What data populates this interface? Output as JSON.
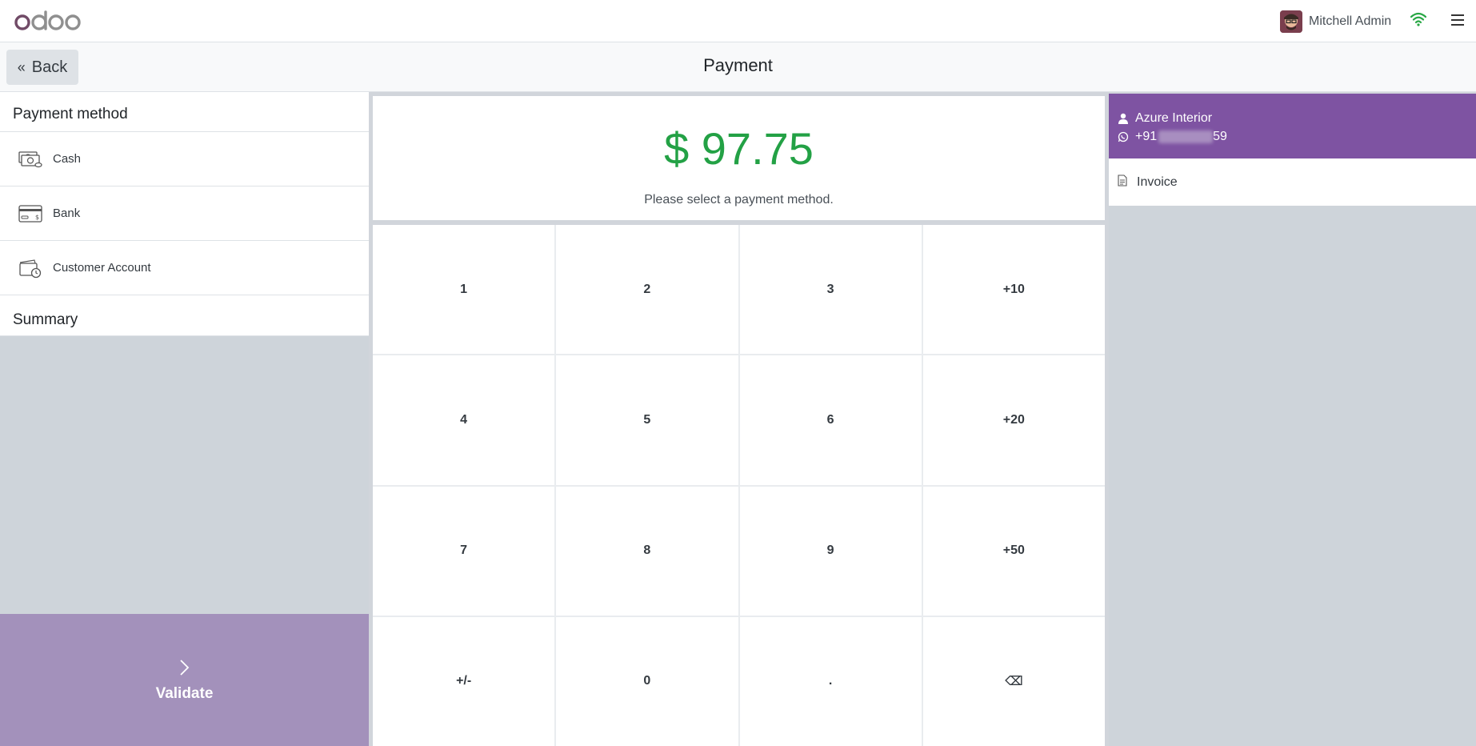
{
  "header": {
    "user_name": "Mitchell Admin"
  },
  "subheader": {
    "back_label": "Back",
    "title": "Payment"
  },
  "payment_methods": {
    "heading": "Payment method",
    "items": [
      {
        "label": "Cash",
        "icon": "cash-icon"
      },
      {
        "label": "Bank",
        "icon": "bank-card-icon"
      },
      {
        "label": "Customer Account",
        "icon": "customer-account-icon"
      }
    ]
  },
  "summary": {
    "heading": "Summary"
  },
  "validate": {
    "label": "Validate",
    "icon": "chevron-right-icon"
  },
  "total": {
    "amount": "$ 97.75",
    "hint": "Please select a payment method."
  },
  "numpad": {
    "keys": [
      "1",
      "2",
      "3",
      "+10",
      "4",
      "5",
      "6",
      "+20",
      "7",
      "8",
      "9",
      "+50",
      "+/-",
      "0",
      ".",
      "⌫"
    ]
  },
  "customer": {
    "name": "Azure Interior",
    "phone_prefix": "+91",
    "phone_suffix": "59"
  },
  "invoice": {
    "label": "Invoice"
  },
  "colors": {
    "brand_purple": "#7e53a2",
    "validate_purple": "#a391bb",
    "total_green": "#23a145",
    "wifi_green": "#28a745"
  }
}
